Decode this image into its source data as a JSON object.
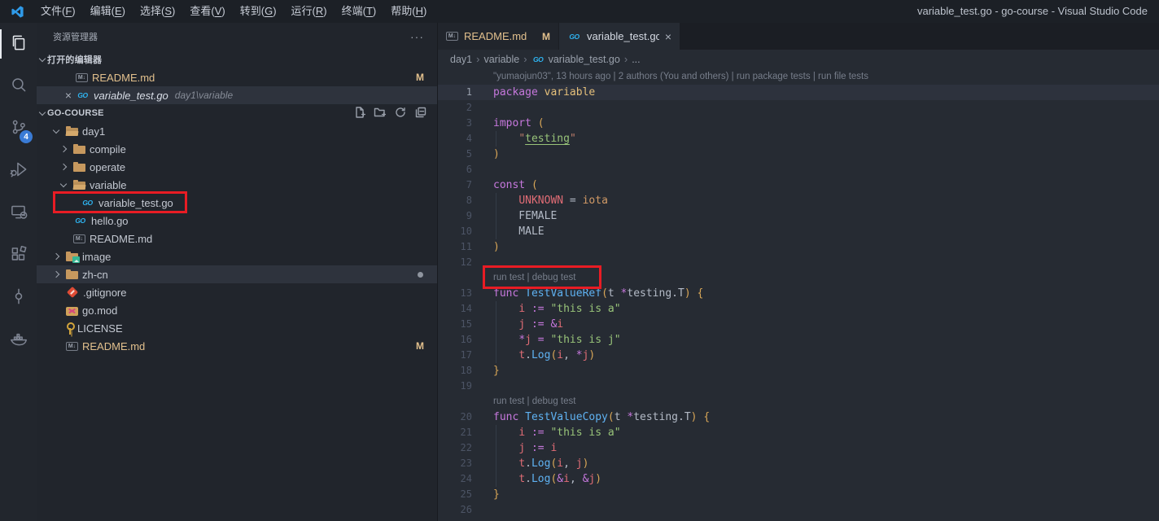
{
  "title_bar": {
    "title": "variable_test.go - go-course - Visual Studio Code",
    "menus": [
      {
        "label": "文件",
        "key": "F"
      },
      {
        "label": "编辑",
        "key": "E"
      },
      {
        "label": "选择",
        "key": "S"
      },
      {
        "label": "查看",
        "key": "V"
      },
      {
        "label": "转到",
        "key": "G"
      },
      {
        "label": "运行",
        "key": "R"
      },
      {
        "label": "终端",
        "key": "T"
      },
      {
        "label": "帮助",
        "key": "H"
      }
    ]
  },
  "activity_bar": {
    "items": [
      {
        "name": "explorer",
        "active": true
      },
      {
        "name": "search"
      },
      {
        "name": "source-control",
        "badge": "4"
      },
      {
        "name": "run-debug"
      },
      {
        "name": "remote-explorer"
      },
      {
        "name": "extensions"
      },
      {
        "name": "commit"
      },
      {
        "name": "docker"
      }
    ]
  },
  "sidebar": {
    "title": "资源管理器",
    "more_actions": "···",
    "open_editors": {
      "header": "打开的编辑器",
      "items": [
        {
          "label": "README.md",
          "icon": "md",
          "badge": "M",
          "modified": true
        },
        {
          "label": "variable_test.go",
          "icon": "go",
          "desc": "day1\\variable",
          "active": true,
          "italic": true,
          "close": "×"
        }
      ]
    },
    "project": {
      "header": "GO-COURSE",
      "actions": [
        "new-file",
        "new-folder",
        "refresh",
        "collapse-all"
      ],
      "tree": [
        {
          "label": "day1",
          "icon": "folder-open",
          "level": 1,
          "twistie": "open"
        },
        {
          "label": "compile",
          "icon": "folder",
          "level": 2,
          "twistie": "closed"
        },
        {
          "label": "operate",
          "icon": "folder",
          "level": 2,
          "twistie": "closed"
        },
        {
          "label": "variable",
          "icon": "folder-open",
          "level": 2,
          "twistie": "open"
        },
        {
          "label": "variable_test.go",
          "icon": "go",
          "level": 3,
          "red_box": true
        },
        {
          "label": "hello.go",
          "icon": "go",
          "level": 2
        },
        {
          "label": "README.md",
          "icon": "md",
          "level": 2
        },
        {
          "label": "image",
          "icon": "folder-image",
          "level": 1,
          "twistie": "closed"
        },
        {
          "label": "zh-cn",
          "icon": "folder",
          "level": 1,
          "twistie": "closed",
          "selected": true,
          "dot": true
        },
        {
          "label": ".gitignore",
          "icon": "git",
          "level": 1
        },
        {
          "label": "go.mod",
          "icon": "gomod",
          "level": 1
        },
        {
          "label": "LICENSE",
          "icon": "license",
          "level": 1
        },
        {
          "label": "README.md",
          "icon": "md",
          "level": 1,
          "badge": "M",
          "modified": true
        }
      ]
    }
  },
  "editor": {
    "tabs": [
      {
        "label": "README.md",
        "icon": "md",
        "flag": "M",
        "modified": true
      },
      {
        "label": "variable_test.go",
        "icon": "go",
        "active": true,
        "italic": true,
        "close": "×"
      }
    ],
    "breadcrumb": [
      {
        "text": "day1"
      },
      {
        "text": "variable"
      },
      {
        "text": "variable_test.go",
        "icon": "go"
      },
      {
        "text": "..."
      }
    ],
    "rows": [
      {
        "t": "lens",
        "name": "gitlens-blame",
        "text": "\"yumaojun03\", 13 hours ago | 2 authors (You and others) | run package tests | run file tests"
      },
      {
        "t": "c",
        "n": 1,
        "hl": true,
        "tk": [
          [
            "kw",
            "package"
          ],
          [
            "pl",
            " "
          ],
          [
            "typ",
            "variable"
          ]
        ]
      },
      {
        "t": "c",
        "n": 2,
        "tk": []
      },
      {
        "t": "c",
        "n": 3,
        "tk": [
          [
            "kw",
            "import"
          ],
          [
            "pl",
            " "
          ],
          [
            "au",
            "("
          ]
        ]
      },
      {
        "t": "c",
        "n": 4,
        "g": true,
        "tk": [
          [
            "pl",
            "    "
          ],
          [
            "sq",
            "\""
          ],
          [
            "lnk",
            "testing"
          ],
          [
            "sq",
            "\""
          ]
        ]
      },
      {
        "t": "c",
        "n": 5,
        "tk": [
          [
            "au",
            ")"
          ]
        ]
      },
      {
        "t": "c",
        "n": 6,
        "tk": []
      },
      {
        "t": "c",
        "n": 7,
        "tk": [
          [
            "kw",
            "const"
          ],
          [
            "pl",
            " "
          ],
          [
            "au",
            "("
          ]
        ]
      },
      {
        "t": "c",
        "n": 8,
        "g": true,
        "tk": [
          [
            "pl",
            "    "
          ],
          [
            "cn",
            "UNKNOWN"
          ],
          [
            "pl",
            " = "
          ],
          [
            "num",
            "iota"
          ]
        ]
      },
      {
        "t": "c",
        "n": 9,
        "g": true,
        "tk": [
          [
            "pl",
            "    FEMALE"
          ]
        ]
      },
      {
        "t": "c",
        "n": 10,
        "g": true,
        "tk": [
          [
            "pl",
            "    MALE"
          ]
        ]
      },
      {
        "t": "c",
        "n": 11,
        "tk": [
          [
            "au",
            ")"
          ]
        ]
      },
      {
        "t": "c",
        "n": 12,
        "tk": []
      },
      {
        "t": "lens",
        "name": "codelens-run-test-1",
        "text": "run test | debug test",
        "box": true
      },
      {
        "t": "c",
        "n": 13,
        "tk": [
          [
            "kw",
            "func"
          ],
          [
            "pl",
            " "
          ],
          [
            "fn",
            "TestValueRef"
          ],
          [
            "au",
            "("
          ],
          [
            "pl",
            "t "
          ],
          [
            "op",
            "*"
          ],
          [
            "pl",
            "testing.T"
          ],
          [
            "au",
            ")"
          ],
          [
            "pl",
            " "
          ],
          [
            "au",
            "{"
          ]
        ]
      },
      {
        "t": "c",
        "n": 14,
        "g": true,
        "tk": [
          [
            "pl",
            "    "
          ],
          [
            "vr",
            "i"
          ],
          [
            "pl",
            " "
          ],
          [
            "op",
            ":="
          ],
          [
            "pl",
            " "
          ],
          [
            "str",
            "\"this is a\""
          ]
        ]
      },
      {
        "t": "c",
        "n": 15,
        "g": true,
        "tk": [
          [
            "pl",
            "    "
          ],
          [
            "vr",
            "j"
          ],
          [
            "pl",
            " "
          ],
          [
            "op",
            ":="
          ],
          [
            "pl",
            " "
          ],
          [
            "op",
            "&"
          ],
          [
            "vr",
            "i"
          ]
        ]
      },
      {
        "t": "c",
        "n": 16,
        "g": true,
        "tk": [
          [
            "pl",
            "    "
          ],
          [
            "op",
            "*"
          ],
          [
            "vr",
            "j"
          ],
          [
            "pl",
            " "
          ],
          [
            "op",
            "="
          ],
          [
            "pl",
            " "
          ],
          [
            "str",
            "\"this is j\""
          ]
        ]
      },
      {
        "t": "c",
        "n": 17,
        "g": true,
        "tk": [
          [
            "pl",
            "    "
          ],
          [
            "vr",
            "t"
          ],
          [
            "pl",
            "."
          ],
          [
            "fn",
            "Log"
          ],
          [
            "au",
            "("
          ],
          [
            "vr",
            "i"
          ],
          [
            "pl",
            ", "
          ],
          [
            "op",
            "*"
          ],
          [
            "vr",
            "j"
          ],
          [
            "au",
            ")"
          ]
        ]
      },
      {
        "t": "c",
        "n": 18,
        "tk": [
          [
            "au",
            "}"
          ]
        ]
      },
      {
        "t": "c",
        "n": 19,
        "tk": []
      },
      {
        "t": "lens",
        "name": "codelens-run-test-2",
        "text": "run test | debug test"
      },
      {
        "t": "c",
        "n": 20,
        "tk": [
          [
            "kw",
            "func"
          ],
          [
            "pl",
            " "
          ],
          [
            "fn",
            "TestValueCopy"
          ],
          [
            "au",
            "("
          ],
          [
            "pl",
            "t "
          ],
          [
            "op",
            "*"
          ],
          [
            "pl",
            "testing.T"
          ],
          [
            "au",
            ")"
          ],
          [
            "pl",
            " "
          ],
          [
            "au",
            "{"
          ]
        ]
      },
      {
        "t": "c",
        "n": 21,
        "g": true,
        "tk": [
          [
            "pl",
            "    "
          ],
          [
            "vr",
            "i"
          ],
          [
            "pl",
            " "
          ],
          [
            "op",
            ":="
          ],
          [
            "pl",
            " "
          ],
          [
            "str",
            "\"this is a\""
          ]
        ]
      },
      {
        "t": "c",
        "n": 22,
        "g": true,
        "tk": [
          [
            "pl",
            "    "
          ],
          [
            "vr",
            "j"
          ],
          [
            "pl",
            " "
          ],
          [
            "op",
            ":="
          ],
          [
            "pl",
            " "
          ],
          [
            "vr",
            "i"
          ]
        ]
      },
      {
        "t": "c",
        "n": 23,
        "g": true,
        "tk": [
          [
            "pl",
            "    "
          ],
          [
            "vr",
            "t"
          ],
          [
            "pl",
            "."
          ],
          [
            "fn",
            "Log"
          ],
          [
            "au",
            "("
          ],
          [
            "vr",
            "i"
          ],
          [
            "pl",
            ", "
          ],
          [
            "vr",
            "j"
          ],
          [
            "au",
            ")"
          ]
        ]
      },
      {
        "t": "c",
        "n": 24,
        "g": true,
        "tk": [
          [
            "pl",
            "    "
          ],
          [
            "vr",
            "t"
          ],
          [
            "pl",
            "."
          ],
          [
            "fn",
            "Log"
          ],
          [
            "au",
            "("
          ],
          [
            "op",
            "&"
          ],
          [
            "vr",
            "i"
          ],
          [
            "pl",
            ", "
          ],
          [
            "op",
            "&"
          ],
          [
            "vr",
            "j"
          ],
          [
            "au",
            ")"
          ]
        ]
      },
      {
        "t": "c",
        "n": 25,
        "tk": [
          [
            "au",
            "}"
          ]
        ]
      },
      {
        "t": "c",
        "n": 26,
        "tk": []
      }
    ]
  },
  "colors": {
    "annotation_red": "#e81c24",
    "git_modified": "#e2c08d",
    "scm_badge": "#3a7bd5",
    "go_icon_blue": "#2eb3f0",
    "editor_bg": "#262b33",
    "sidebar_bg": "#21252c",
    "current_line": "#2d323d"
  }
}
